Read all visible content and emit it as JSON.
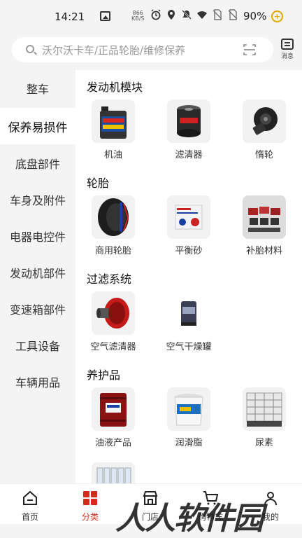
{
  "status": {
    "time": "14:21",
    "speed_value": "866",
    "speed_unit": "KB/S",
    "battery": "90%"
  },
  "search": {
    "placeholder": "沃尔沃卡车/正品轮胎/维修保养"
  },
  "message": {
    "label": "消息"
  },
  "sidebar": {
    "items": [
      {
        "label": "整车"
      },
      {
        "label": "保养易损件"
      },
      {
        "label": "底盘部件"
      },
      {
        "label": "车身及附件"
      },
      {
        "label": "电器电控件"
      },
      {
        "label": "发动机部件"
      },
      {
        "label": "变速箱部件"
      },
      {
        "label": "工具设备"
      },
      {
        "label": "车辆用品"
      }
    ],
    "active_index": 1
  },
  "sections": [
    {
      "title": "发动机模块",
      "items": [
        {
          "label": "机油",
          "icon": "oil-can"
        },
        {
          "label": "滤清器",
          "icon": "oil-filter"
        },
        {
          "label": "惰轮",
          "icon": "idler-pulley"
        }
      ]
    },
    {
      "title": "轮胎",
      "items": [
        {
          "label": "商用轮胎",
          "icon": "tire"
        },
        {
          "label": "平衡砂",
          "icon": "balance-sand-box"
        },
        {
          "label": "补胎材料",
          "icon": "tire-patch-kit"
        }
      ]
    },
    {
      "title": "过滤系统",
      "items": [
        {
          "label": "空气滤清器",
          "icon": "air-filter"
        },
        {
          "label": "空气干燥罐",
          "icon": "air-dryer"
        }
      ]
    },
    {
      "title": "养护品",
      "items": [
        {
          "label": "油液产品",
          "icon": "oil-drum"
        },
        {
          "label": "润滑脂",
          "icon": "grease-bucket"
        },
        {
          "label": "尿素",
          "icon": "urea-tank"
        }
      ]
    }
  ],
  "tabs": [
    {
      "label": "首页",
      "icon": "home-icon"
    },
    {
      "label": "分类",
      "icon": "category-icon"
    },
    {
      "label": "门店",
      "icon": "store-icon"
    },
    {
      "label": "购物车",
      "icon": "cart-icon"
    },
    {
      "label": "我的",
      "icon": "profile-icon"
    }
  ],
  "colors": {
    "accent": "#d42b1c",
    "background": "#f4f4f4",
    "panel": "#ffffff"
  },
  "watermark": "人人软件园"
}
